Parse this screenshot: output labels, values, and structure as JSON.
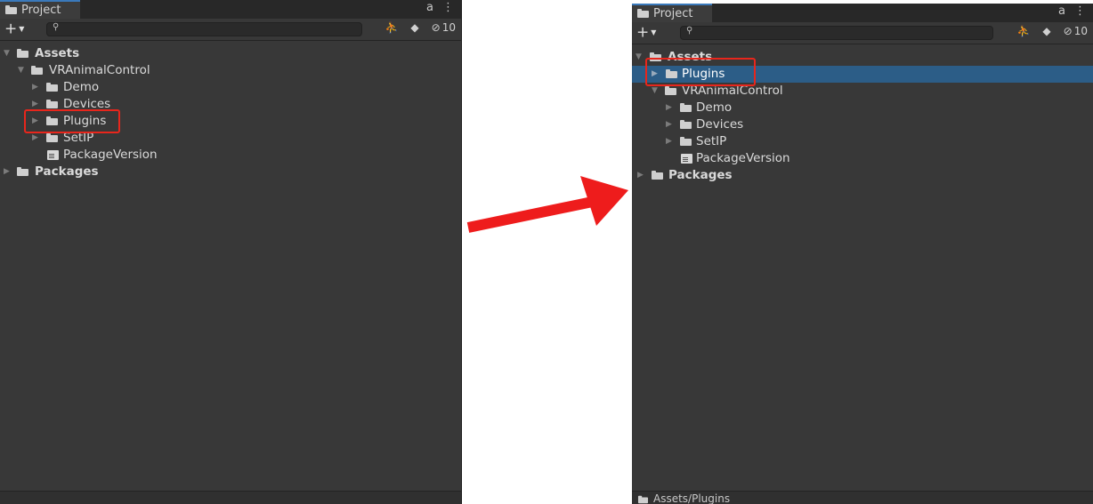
{
  "left": {
    "tab_label": "Project",
    "lock_icon": "lock-icon",
    "menu_icon": "kebab-menu-icon",
    "add_label": "+",
    "hidden_count": "10",
    "tree": {
      "assets": "Assets",
      "vranimalcontrol": "VRAnimalControl",
      "demo": "Demo",
      "devices": "Devices",
      "plugins": "Plugins",
      "setip": "SetIP",
      "packageversion": "PackageVersion",
      "packages": "Packages"
    }
  },
  "right": {
    "tab_label": "Project",
    "add_label": "+",
    "hidden_count": "10",
    "tree": {
      "assets": "Assets",
      "plugins": "Plugins",
      "vranimalcontrol": "VRAnimalControl",
      "demo": "Demo",
      "devices": "Devices",
      "setip": "SetIP",
      "packageversion": "PackageVersion",
      "packages": "Packages"
    },
    "status_path": "Assets/Plugins"
  },
  "colors": {
    "highlight": "#e8261c",
    "selection": "#2c5d87",
    "panel_bg": "#383838"
  }
}
